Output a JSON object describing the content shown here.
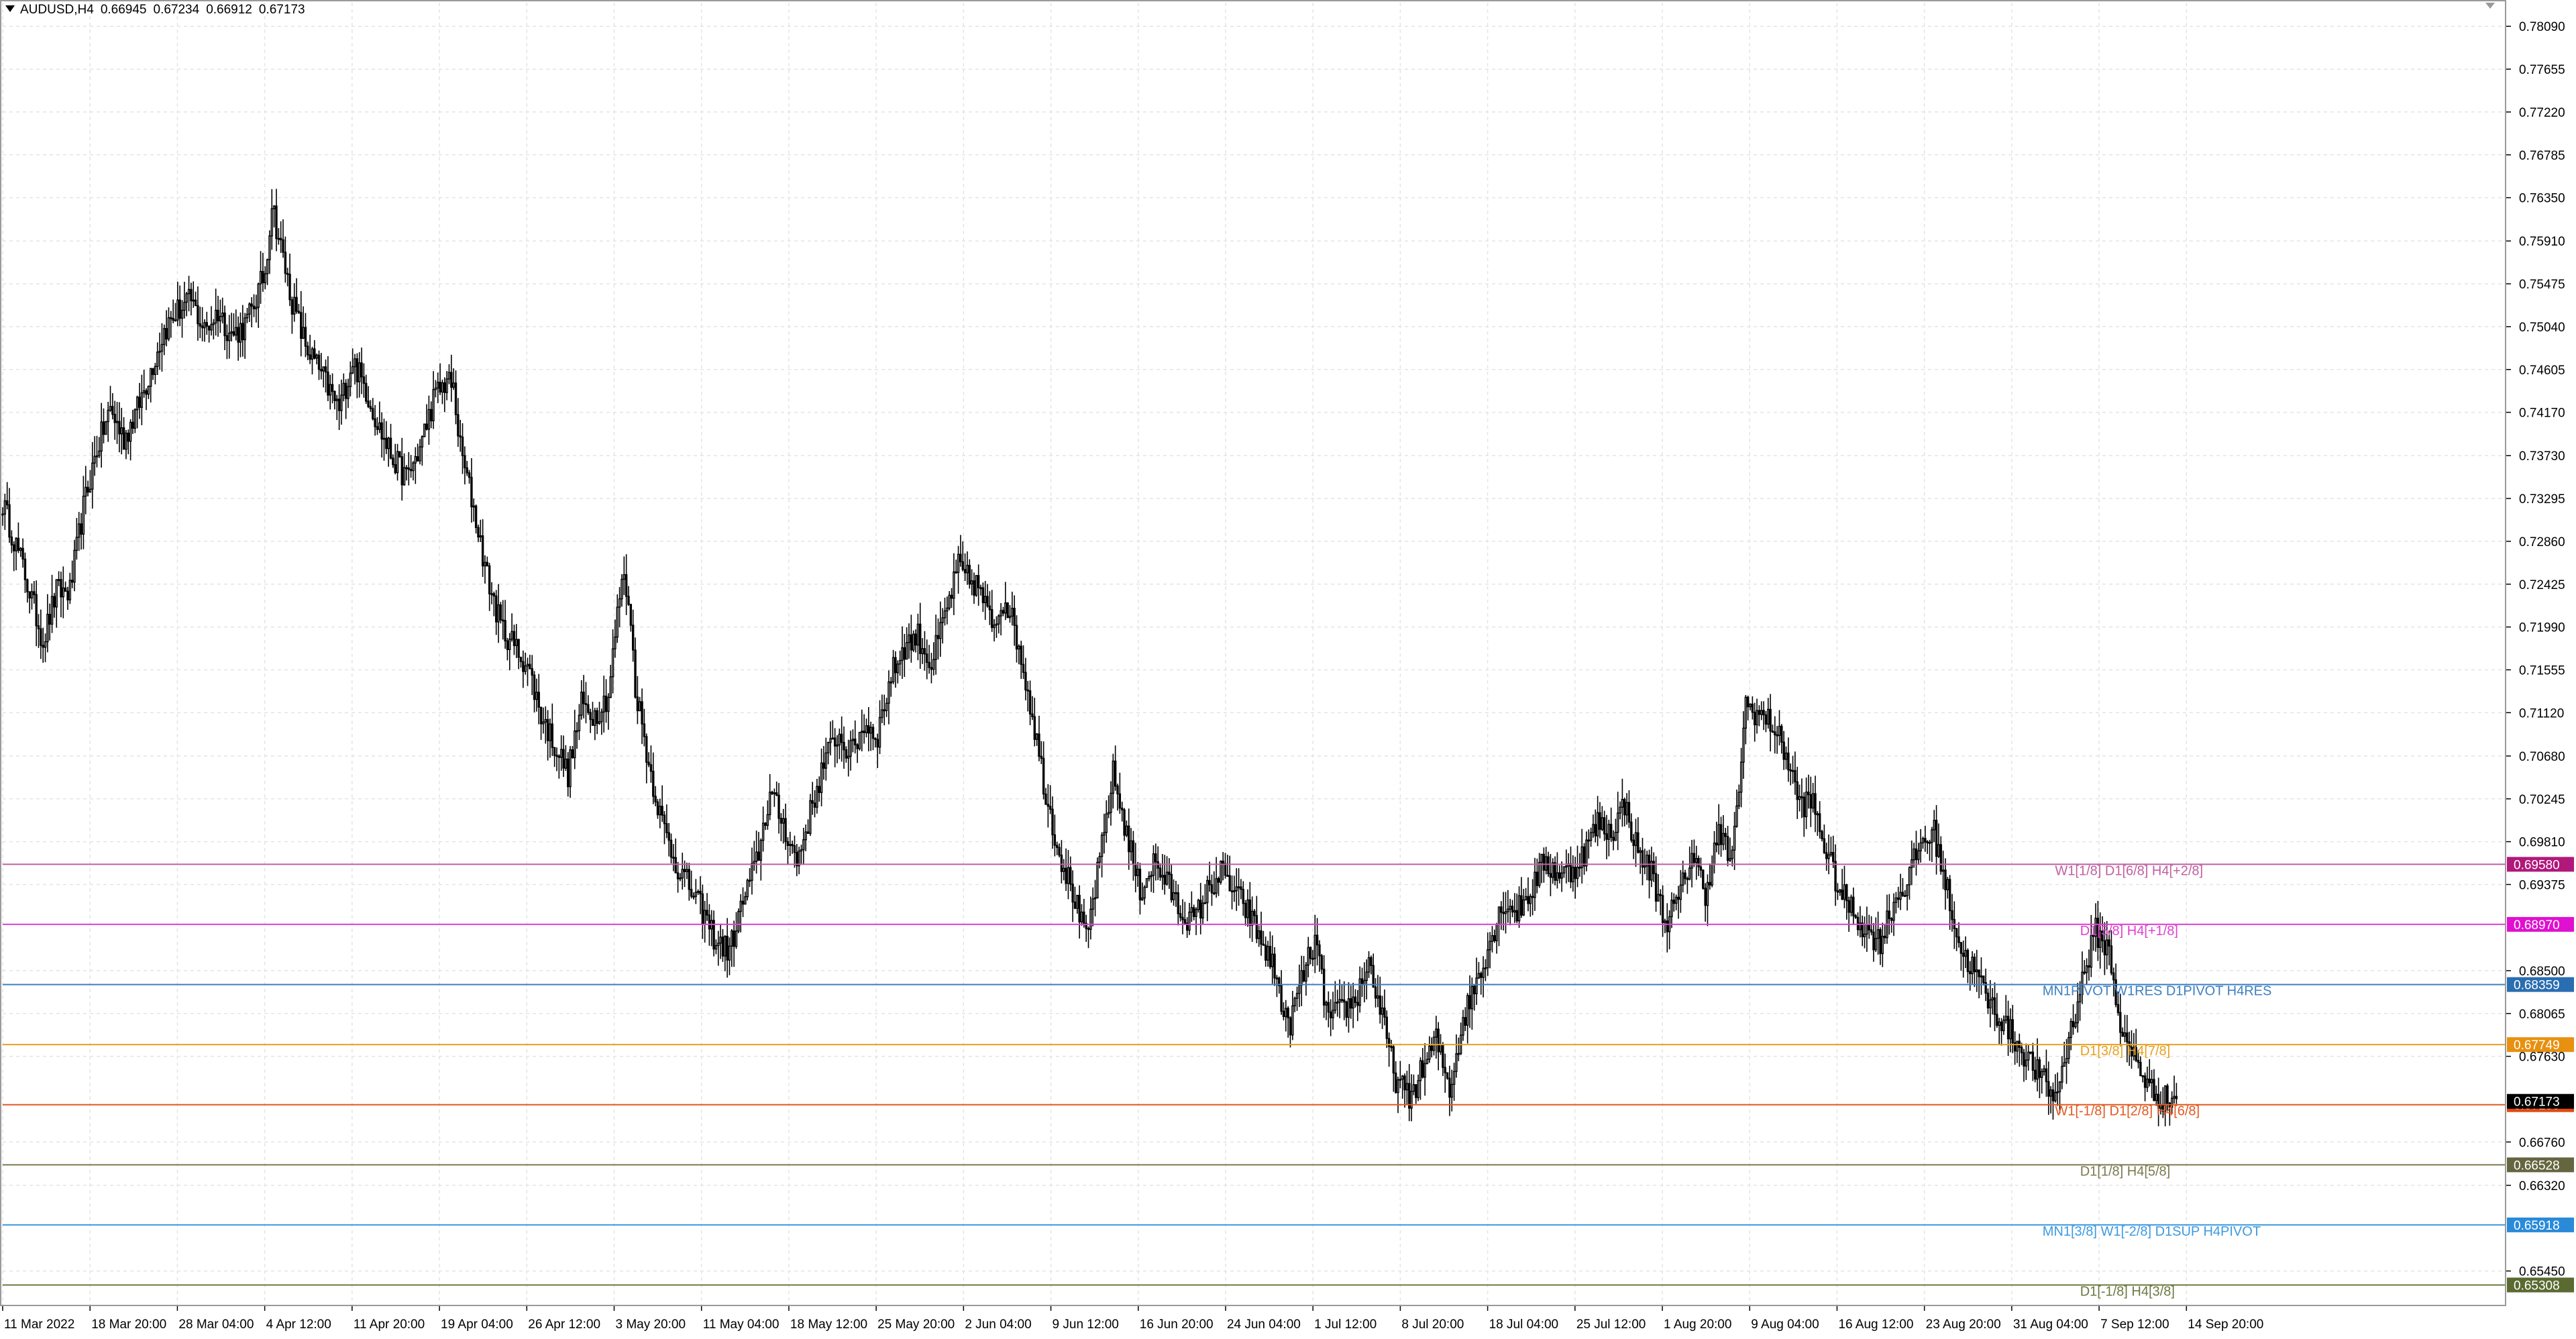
{
  "header": {
    "symbol": "AUDUSD,H4",
    "open": "0.66945",
    "high": "0.67234",
    "low": "0.66912",
    "close": "0.67173"
  },
  "colors": {
    "background": "#ffffff",
    "grid": "#e4e4e4",
    "candle": "#000000",
    "axis_text": "#000000",
    "current_price_bg": "#000000"
  },
  "chart_data": {
    "type": "candlestick",
    "symbol": "AUDUSD",
    "timeframe": "H4",
    "ylim": [
      0.651,
      0.7833
    ],
    "grid": true,
    "y_ticks": [
      "0.78090",
      "0.77655",
      "0.77220",
      "0.76785",
      "0.76350",
      "0.75910",
      "0.75475",
      "0.75040",
      "0.74605",
      "0.74170",
      "0.73730",
      "0.73295",
      "0.72860",
      "0.72425",
      "0.71990",
      "0.71555",
      "0.71120",
      "0.70680",
      "0.70245",
      "0.69810",
      "0.69375",
      "0.68500",
      "0.68065",
      "0.67630",
      "0.66760",
      "0.66320",
      "0.65450"
    ],
    "x_ticks": [
      "11 Mar 2022",
      "18 Mar 20:00",
      "28 Mar 04:00",
      "4 Apr 12:00",
      "11 Apr 20:00",
      "19 Apr 04:00",
      "26 Apr 12:00",
      "3 May 20:00",
      "11 May 04:00",
      "18 May 12:00",
      "25 May 20:00",
      "2 Jun 04:00",
      "9 Jun 12:00",
      "16 Jun 20:00",
      "24 Jun 04:00",
      "1 Jul 12:00",
      "8 Jul 20:00",
      "18 Jul 04:00",
      "25 Jul 12:00",
      "1 Aug 20:00",
      "9 Aug 04:00",
      "16 Aug 12:00",
      "23 Aug 20:00",
      "31 Aug 04:00",
      "7 Sep 12:00",
      "14 Sep 20:00"
    ],
    "current_price": {
      "value": 0.67173,
      "label": "0.67173"
    },
    "price_path": [
      [
        0,
        0.7325
      ],
      [
        3,
        0.726
      ],
      [
        6,
        0.7185
      ],
      [
        8,
        0.7235
      ],
      [
        10,
        0.7235
      ],
      [
        12,
        0.732
      ],
      [
        14,
        0.738
      ],
      [
        16,
        0.742
      ],
      [
        18,
        0.739
      ],
      [
        20,
        0.742
      ],
      [
        22,
        0.746
      ],
      [
        24,
        0.75
      ],
      [
        26,
        0.752
      ],
      [
        28,
        0.753
      ],
      [
        30,
        0.75
      ],
      [
        32,
        0.752
      ],
      [
        34,
        0.7495
      ],
      [
        36,
        0.7505
      ],
      [
        37,
        0.752
      ],
      [
        39,
        0.756
      ],
      [
        40,
        0.763
      ],
      [
        41,
        0.7595
      ],
      [
        43,
        0.753
      ],
      [
        45,
        0.7485
      ],
      [
        47,
        0.746
      ],
      [
        50,
        0.742
      ],
      [
        52,
        0.747
      ],
      [
        54,
        0.744
      ],
      [
        56,
        0.74
      ],
      [
        58,
        0.737
      ],
      [
        60,
        0.735
      ],
      [
        62,
        0.738
      ],
      [
        64,
        0.743
      ],
      [
        66,
        0.745
      ],
      [
        67,
        0.744
      ],
      [
        68,
        0.738
      ],
      [
        70,
        0.732
      ],
      [
        72,
        0.725
      ],
      [
        74,
        0.72
      ],
      [
        76,
        0.718
      ],
      [
        78,
        0.716
      ],
      [
        80,
        0.711
      ],
      [
        82,
        0.708
      ],
      [
        84,
        0.705
      ],
      [
        86,
        0.712
      ],
      [
        88,
        0.711
      ],
      [
        90,
        0.713
      ],
      [
        92,
        0.725
      ],
      [
        93,
        0.723
      ],
      [
        94,
        0.714
      ],
      [
        96,
        0.706
      ],
      [
        98,
        0.7
      ],
      [
        100,
        0.696
      ],
      [
        102,
        0.6935
      ],
      [
        104,
        0.691
      ],
      [
        106,
        0.688
      ],
      [
        108,
        0.687
      ],
      [
        110,
        0.692
      ],
      [
        112,
        0.696
      ],
      [
        114,
        0.703
      ],
      [
        116,
        0.7
      ],
      [
        118,
        0.696
      ],
      [
        120,
        0.701
      ],
      [
        122,
        0.706
      ],
      [
        124,
        0.709
      ],
      [
        126,
        0.707
      ],
      [
        128,
        0.71
      ],
      [
        130,
        0.709
      ],
      [
        132,
        0.715
      ],
      [
        134,
        0.718
      ],
      [
        136,
        0.719
      ],
      [
        138,
        0.716
      ],
      [
        140,
        0.721
      ],
      [
        142,
        0.726
      ],
      [
        143,
        0.725
      ],
      [
        145,
        0.724
      ],
      [
        147,
        0.72
      ],
      [
        149,
        0.723
      ],
      [
        151,
        0.718
      ],
      [
        153,
        0.711
      ],
      [
        155,
        0.703
      ],
      [
        157,
        0.697
      ],
      [
        159,
        0.693
      ],
      [
        161,
        0.688
      ],
      [
        163,
        0.696
      ],
      [
        165,
        0.705
      ],
      [
        167,
        0.699
      ],
      [
        169,
        0.693
      ],
      [
        171,
        0.696
      ],
      [
        173,
        0.694
      ],
      [
        175,
        0.691
      ],
      [
        177,
        0.69
      ],
      [
        179,
        0.693
      ],
      [
        181,
        0.695
      ],
      [
        183,
        0.693
      ],
      [
        185,
        0.691
      ],
      [
        187,
        0.688
      ],
      [
        189,
        0.685
      ],
      [
        191,
        0.679
      ],
      [
        193,
        0.684
      ],
      [
        195,
        0.688
      ],
      [
        197,
        0.68
      ],
      [
        199,
        0.681
      ],
      [
        201,
        0.682
      ],
      [
        203,
        0.686
      ],
      [
        205,
        0.68
      ],
      [
        207,
        0.674
      ],
      [
        209,
        0.672
      ],
      [
        211,
        0.675
      ],
      [
        213,
        0.678
      ],
      [
        215,
        0.673
      ],
      [
        217,
        0.68
      ],
      [
        219,
        0.684
      ],
      [
        221,
        0.688
      ],
      [
        223,
        0.692
      ],
      [
        225,
        0.691
      ],
      [
        227,
        0.693
      ],
      [
        229,
        0.696
      ],
      [
        231,
        0.695
      ],
      [
        233,
        0.695
      ],
      [
        235,
        0.697
      ],
      [
        237,
        0.7
      ],
      [
        239,
        0.699
      ],
      [
        241,
        0.702
      ],
      [
        243,
        0.697
      ],
      [
        245,
        0.695
      ],
      [
        247,
        0.69
      ],
      [
        249,
        0.692
      ],
      [
        251,
        0.697
      ],
      [
        253,
        0.693
      ],
      [
        255,
        0.699
      ],
      [
        257,
        0.696
      ],
      [
        259,
        0.712
      ],
      [
        261,
        0.711
      ],
      [
        263,
        0.71
      ],
      [
        265,
        0.707
      ],
      [
        267,
        0.702
      ],
      [
        269,
        0.702
      ],
      [
        271,
        0.697
      ],
      [
        273,
        0.693
      ],
      [
        275,
        0.691
      ],
      [
        277,
        0.689
      ],
      [
        279,
        0.688
      ],
      [
        281,
        0.692
      ],
      [
        283,
        0.694
      ],
      [
        285,
        0.698
      ],
      [
        287,
        0.699
      ],
      [
        289,
        0.693
      ],
      [
        291,
        0.687
      ],
      [
        293,
        0.685
      ],
      [
        295,
        0.682
      ],
      [
        297,
        0.68
      ],
      [
        299,
        0.678
      ],
      [
        301,
        0.676
      ],
      [
        303,
        0.674
      ],
      [
        305,
        0.672
      ],
      [
        307,
        0.678
      ],
      [
        309,
        0.684
      ],
      [
        311,
        0.689
      ],
      [
        313,
        0.687
      ],
      [
        315,
        0.678
      ],
      [
        317,
        0.676
      ],
      [
        319,
        0.673
      ],
      [
        321,
        0.672
      ],
      [
        323,
        0.672
      ]
    ],
    "levels": [
      {
        "price": 0.6958,
        "label": "W1[1/8] D1[6/8] H4[+2/8]",
        "color": "#c060a0",
        "badge_text": "0.69580",
        "badge_bg": "#b0187a",
        "label_xfrac": 0.82
      },
      {
        "price": 0.6897,
        "label": "D1[5/8] H4[+1/8]",
        "color": "#e040d0",
        "badge_text": "0.68970",
        "badge_bg": "#e010d0",
        "label_xfrac": 0.83
      },
      {
        "price": 0.68359,
        "label": "MN1PIVOT W1RES D1PIVOT H4RES",
        "color": "#3d7fc0",
        "badge_text": "0.68359",
        "badge_bg": "#2a6db0",
        "label_xfrac": 0.815
      },
      {
        "price": 0.67749,
        "label": "D1[3/8] H4[7/8]",
        "color": "#e8a020",
        "badge_text": "0.67749",
        "badge_bg": "#e89010",
        "label_xfrac": 0.83
      },
      {
        "price": 0.67139,
        "label": "W1[-1/8] D1[2/8] H4[6/8]",
        "color": "#e05a20",
        "badge_text": "0.67139",
        "badge_bg": "#e04a10",
        "label_xfrac": 0.82
      },
      {
        "price": 0.66528,
        "label": "D1[1/8] H4[5/8]",
        "color": "#7a7a50",
        "badge_text": "0.66528",
        "badge_bg": "#656540",
        "label_xfrac": 0.83
      },
      {
        "price": 0.65918,
        "label": "MN1[3/8] W1[-2/8] D1SUP H4PIVOT",
        "color": "#3d9ae0",
        "badge_text": "0.65918",
        "badge_bg": "#2a8ad8",
        "label_xfrac": 0.815
      },
      {
        "price": 0.65308,
        "label": "D1[-1/8] H4[3/8]",
        "color": "#6a7a40",
        "badge_text": "0.65308",
        "badge_bg": "#5a6a30",
        "label_xfrac": 0.83
      }
    ]
  }
}
